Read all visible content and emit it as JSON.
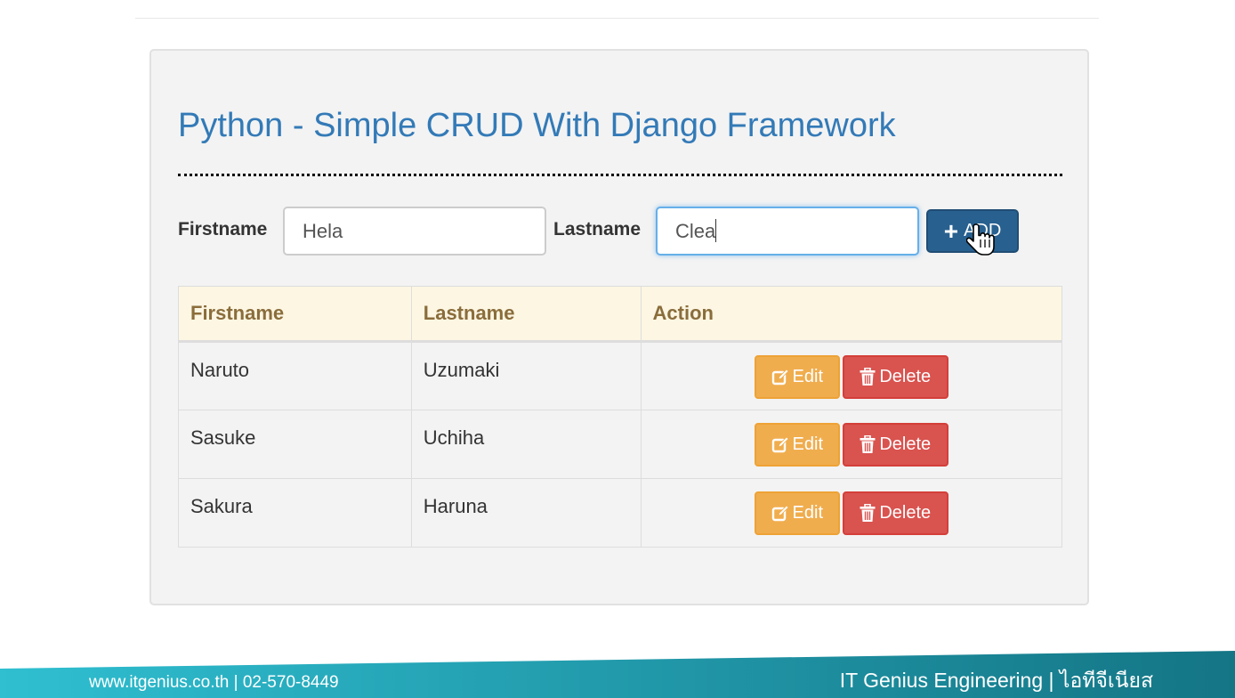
{
  "page": {
    "title": "Python - Simple CRUD With Django Framework"
  },
  "form": {
    "firstname_label": "Firstname",
    "firstname_value": "Hela",
    "lastname_label": "Lastname",
    "lastname_value": "Clea",
    "add_button_label": "ADD"
  },
  "table": {
    "headers": [
      "Firstname",
      "Lastname",
      "Action"
    ],
    "rows": [
      {
        "firstname": "Naruto",
        "lastname": "Uzumaki"
      },
      {
        "firstname": "Sasuke",
        "lastname": "Uchiha"
      },
      {
        "firstname": "Sakura",
        "lastname": "Haruna"
      }
    ],
    "edit_label": "Edit",
    "delete_label": "Delete"
  },
  "footer": {
    "left": "www.itgenius.co.th | 02-570-8449",
    "right": "IT Genius Engineering | ไอทีจีเนียส"
  },
  "icons": {
    "add": "plus-icon",
    "edit": "edit-icon",
    "delete": "trash-icon",
    "pointer": "hand-pointer-icon"
  },
  "colors": {
    "title": "#337ab7",
    "primary": "#286090",
    "warning": "#f0ad4e",
    "danger": "#d9534f",
    "table_header_bg": "#fcf6e3",
    "table_header_text": "#8a6d3b",
    "footer_start": "#2fbfd1",
    "footer_end": "#147585"
  }
}
